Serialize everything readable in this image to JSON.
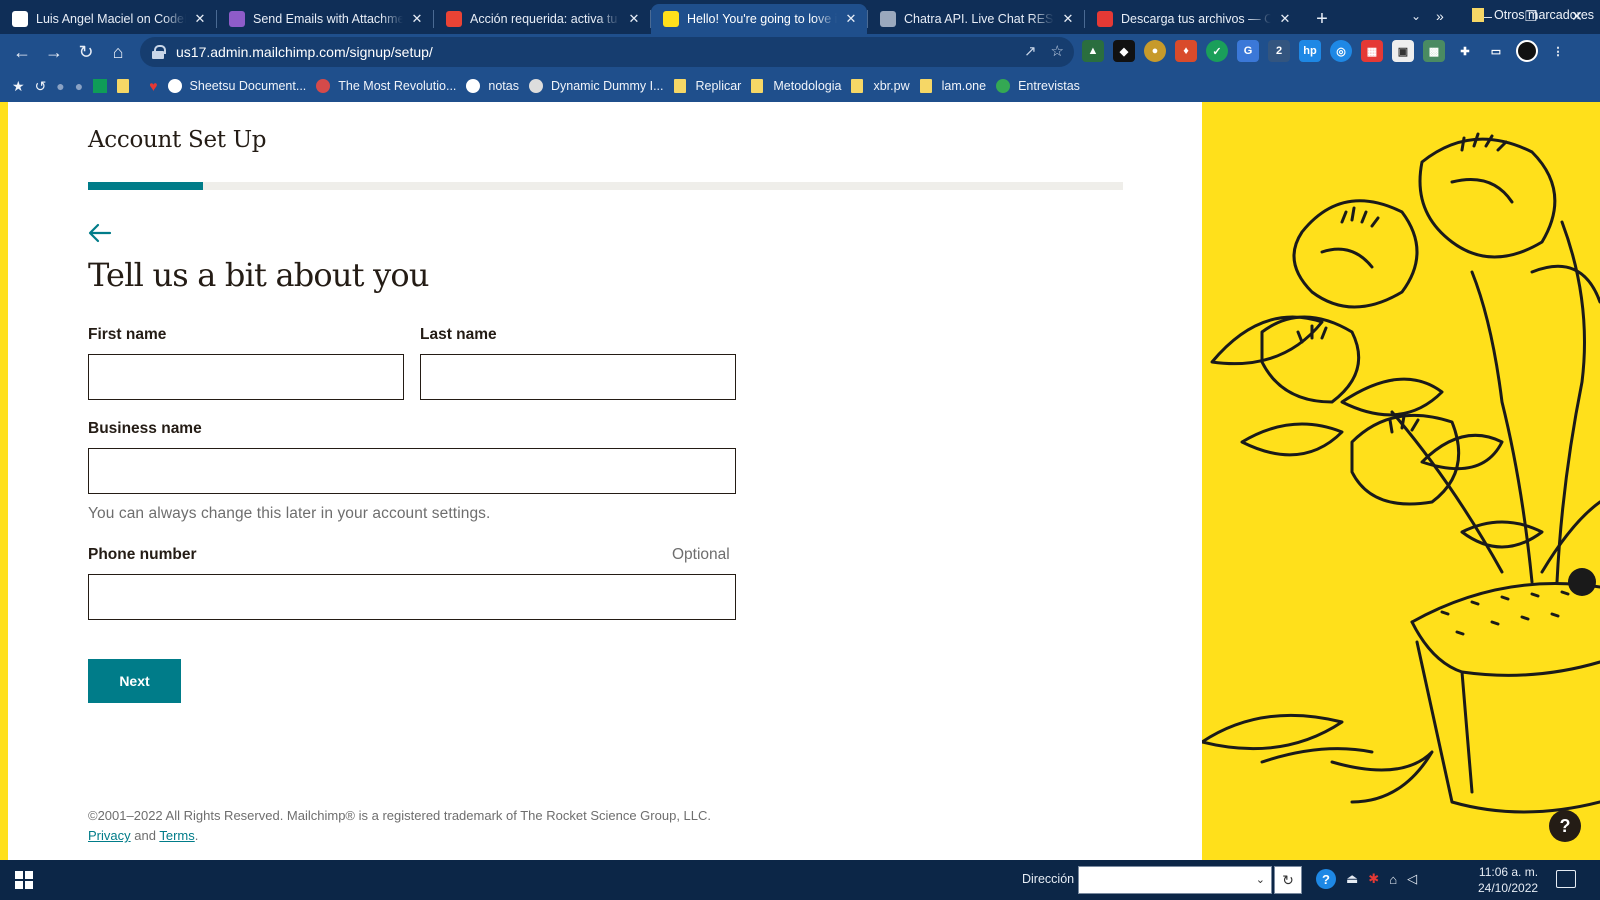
{
  "browser": {
    "tabs": [
      {
        "title": "Luis Angel Maciel on CodePen",
        "favicon_color": "#ffffff",
        "active": false
      },
      {
        "title": "Send Emails with Attachments",
        "favicon_color": "#8e5cc9",
        "active": false
      },
      {
        "title": "Acción requerida: activa tu w",
        "favicon_color": "#ea4335",
        "active": false
      },
      {
        "title": "Hello! You're going to love it",
        "favicon_color": "#ffe01b",
        "active": true
      },
      {
        "title": "Chatra API. Live Chat REST y",
        "favicon_color": "#9aa8bd",
        "active": false
      },
      {
        "title": "Descarga tus archivos — Con",
        "favicon_color": "#e53935",
        "active": false
      }
    ],
    "close_glyph": "✕",
    "new_tab_glyph": "+",
    "url": "us17.admin.mailchimp.com/signup/setup/",
    "window_controls": {
      "minimize": "—",
      "maximize": "❐",
      "close": "✕"
    },
    "bookmarks": [
      {
        "label": "Sheetsu Document...",
        "type": "link",
        "color": "#ffffff"
      },
      {
        "label": "The Most Revolutio...",
        "type": "link",
        "color": "#d54a4a"
      },
      {
        "label": "notas",
        "type": "link",
        "color": "#ffffff"
      },
      {
        "label": "Dynamic Dummy I...",
        "type": "link",
        "color": "#dddddd"
      },
      {
        "label": "Replicar",
        "type": "folder"
      },
      {
        "label": "Metodologia",
        "type": "folder"
      },
      {
        "label": "xbr.pw",
        "type": "folder"
      },
      {
        "label": "lam.one",
        "type": "folder"
      },
      {
        "label": "Entrevistas",
        "type": "link",
        "color": "#34a853"
      }
    ],
    "bookmarks_more": "»",
    "other_bookmarks": "Otros marcadores"
  },
  "page": {
    "title": "Account Set Up",
    "progress": 0.111,
    "heading": "Tell us a bit about you",
    "first_name_label": "First name",
    "first_name_value": "",
    "last_name_label": "Last name",
    "last_name_value": "",
    "business_name_label": "Business name",
    "business_name_value": "",
    "business_helper": "You can always change this later in your account settings.",
    "phone_label": "Phone number",
    "phone_optional": "Optional",
    "phone_value": "",
    "next_label": "Next",
    "footer_text": "©2001–2022 All Rights Reserved. Mailchimp® is a registered trademark of The Rocket Science Group, LLC.",
    "privacy_link": "Privacy",
    "and_text": "and",
    "terms_link": "Terms",
    "footer_period": ".",
    "help_label": "?",
    "accent_color": "#007c89",
    "brand_yellow": "#ffe01b"
  },
  "taskbar": {
    "address_label": "Dirección",
    "address_value": "",
    "time": "11:06 a. m.",
    "date": "24/10/2022"
  }
}
